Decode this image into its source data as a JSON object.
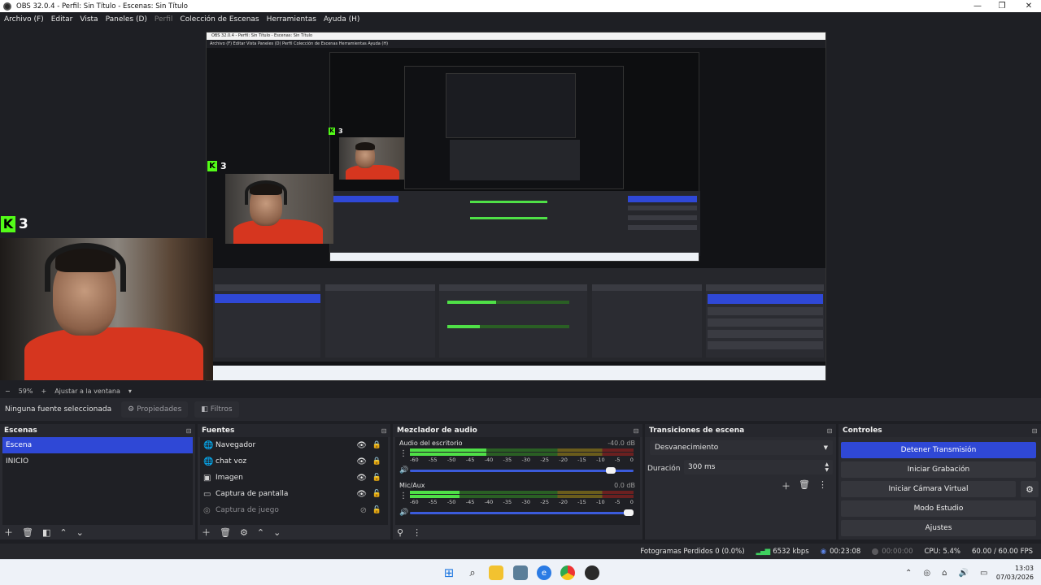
{
  "window": {
    "title": "OBS 32.0.4 - Perfil: Sin Título - Escenas: Sin Título",
    "controls": {
      "minimize": "—",
      "maximize": "❐",
      "close": "✕"
    }
  },
  "menu": {
    "archivo": "Archivo (F)",
    "editar": "Editar",
    "vista": "Vista",
    "paneles": "Paneles (D)",
    "perfil": "Perfil",
    "coleccion": "Colección de Escenas",
    "herramientas": "Herramientas",
    "ayuda": "Ayuda (H)"
  },
  "preview": {
    "badge_number": "3",
    "badge_letter": "K",
    "nested_title": "OBS 32.0.4 - Perfil: Sin Título - Escenas: Sin Título",
    "nested_menu": "Archivo (F)   Editar   Vista   Paneles (D)   Perfil   Colección de Escenas   Herramientas   Ayuda (H)"
  },
  "zoom": {
    "minus": "−",
    "value": "59%",
    "plus": "+",
    "fit": "Ajustar a la ventana",
    "dropdown": "▾"
  },
  "source_toolbar": {
    "no_selection": "Ninguna fuente seleccionada",
    "properties": "Propiedades",
    "filters": "Filtros"
  },
  "scenes": {
    "title": "Escenas",
    "items": [
      {
        "label": "Escena",
        "active": true
      },
      {
        "label": "INICIO",
        "active": false
      }
    ]
  },
  "sources": {
    "title": "Fuentes",
    "items": [
      {
        "label": "Navegador",
        "icon": "globe-icon",
        "glyph": "🌐",
        "dim": false
      },
      {
        "label": "chat voz",
        "icon": "globe-icon",
        "glyph": "🌐",
        "dim": false
      },
      {
        "label": "Imagen",
        "icon": "image-icon",
        "glyph": "▣",
        "dim": false
      },
      {
        "label": "Captura de pantalla",
        "icon": "monitor-icon",
        "glyph": "▭",
        "dim": false
      },
      {
        "label": "Captura de juego",
        "icon": "gamepad-icon",
        "glyph": "◎",
        "dim": true
      }
    ]
  },
  "mixer": {
    "title": "Mezclador de audio",
    "scale": [
      "-60",
      "-55",
      "-50",
      "-45",
      "-40",
      "-35",
      "-30",
      "-25",
      "-20",
      "-15",
      "-10",
      "-5",
      "0"
    ],
    "channels": [
      {
        "name": "Audio del escritorio",
        "db": "-40.0 dB",
        "level": 0.34,
        "volume": 0.92
      },
      {
        "name": "Mic/Aux",
        "db": "0.0 dB",
        "level": 0.22,
        "volume": 1.0
      }
    ]
  },
  "transitions": {
    "title": "Transiciones de escena",
    "selected": "Desvanecimiento",
    "duration_label": "Duración",
    "duration_value": "300 ms"
  },
  "controls": {
    "title": "Controles",
    "stop_stream": "Detener Transmisión",
    "start_recording": "Iniciar Grabación",
    "start_virtual_cam": "Iniciar Cámara Virtual",
    "studio_mode": "Modo Estudio",
    "settings": "Ajustes"
  },
  "status": {
    "dropped_frames": "Fotogramas Perdidos 0 (0.0%)",
    "bitrate": "6532 kbps",
    "stream_time": "00:23:08",
    "record_time": "00:00:00",
    "cpu": "CPU: 5.4%",
    "fps": "60.00 / 60.00 FPS"
  },
  "taskbar": {
    "time": "13:03",
    "date": "07/03/2026"
  },
  "colors": {
    "accent_blue": "#2f48d6",
    "kick_green": "#53fc18"
  }
}
